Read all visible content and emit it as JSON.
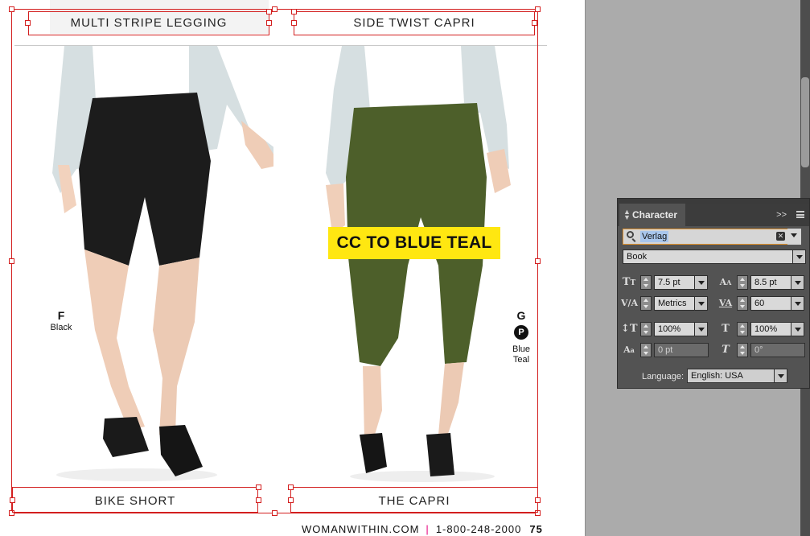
{
  "layout_page": {
    "products": [
      {
        "name": "MULTI STRIPE LEGGING"
      },
      {
        "name": "SIDE TWIST CAPRI"
      },
      {
        "name": "BIKE SHORT"
      },
      {
        "name": "THE CAPRI"
      }
    ],
    "callout": "CC TO BLUE TEAL",
    "swatches": [
      {
        "code": "F",
        "color": "Black"
      },
      {
        "code": "G",
        "badge": "P",
        "color_line1": "Blue",
        "color_line2": "Teal"
      }
    ],
    "footer": {
      "site": "WOMANWITHIN.COM",
      "separator": "|",
      "phone": "1-800-248-2000",
      "page_number": "75"
    },
    "colors": {
      "frame": "#d31f1f",
      "callout_bg": "#ffe711",
      "footer_separator": "#e6007e",
      "legging_black": "#1c1c1c",
      "capri_green": "#4d5f2a"
    }
  },
  "character_panel": {
    "title": "Character",
    "font_family": "Verlag",
    "font_style": "Book",
    "font_size": "7.5 pt",
    "leading": "8.5 pt",
    "kerning": "Metrics",
    "tracking": "60",
    "vertical_scale": "100%",
    "horizontal_scale": "100%",
    "baseline_shift": "0 pt",
    "skew": "0°",
    "language_label": "Language:",
    "language": "English: USA",
    "icons": {
      "font_size": "font-size-icon",
      "leading": "leading-icon",
      "kerning": "kerning-icon",
      "tracking": "tracking-icon",
      "vertical_scale": "vertical-scale-icon",
      "horizontal_scale": "horizontal-scale-icon",
      "baseline_shift": "baseline-shift-icon",
      "skew": "skew-icon"
    }
  }
}
